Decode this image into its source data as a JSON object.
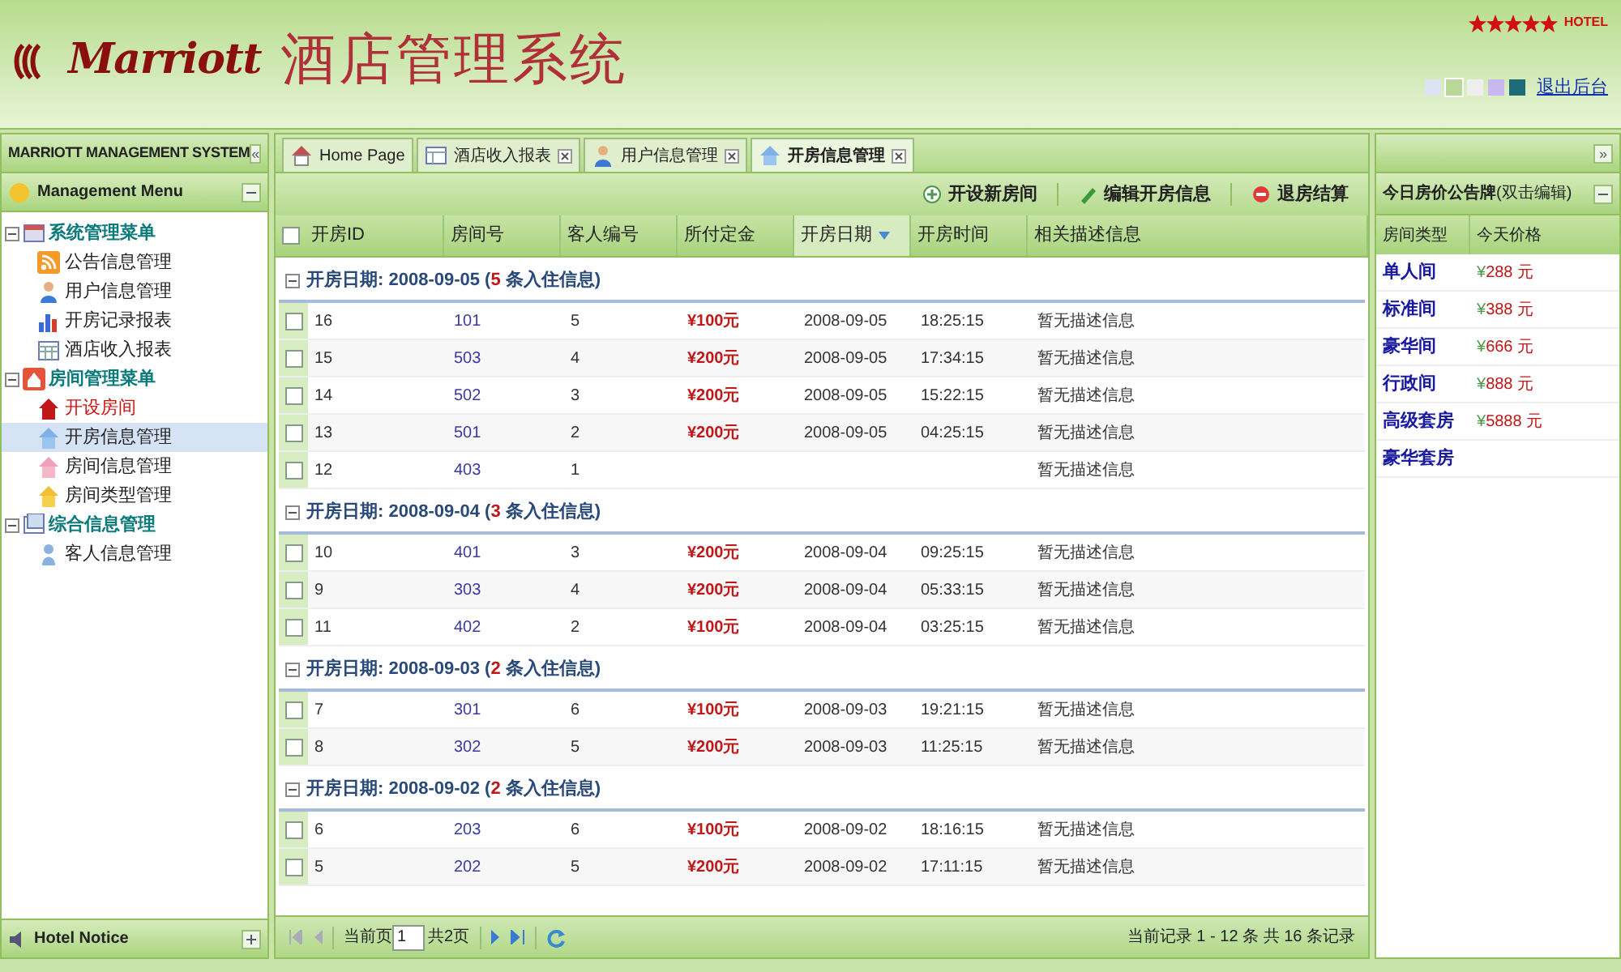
{
  "header": {
    "logo": "Marriott",
    "title": "酒店管理系统",
    "stars": 5,
    "rating_label": "HOTEL",
    "theme_swatches": [
      {
        "color": "#dde3f3",
        "selected": false
      },
      {
        "color": "#b9d99a",
        "selected": true
      },
      {
        "color": "#eeeeee",
        "selected": false
      },
      {
        "color": "#c9b8f0",
        "selected": false
      },
      {
        "color": "#1e6b78",
        "selected": false
      }
    ],
    "logout": "退出后台"
  },
  "sidebar": {
    "title": "MARRIOTT MANAGEMENT SYSTEM",
    "collapse": "«",
    "menu_title": "Management Menu",
    "tree": [
      {
        "label": "系统管理菜单",
        "expanded": true,
        "children": [
          {
            "label": "公告信息管理",
            "selected": false,
            "accent": false
          },
          {
            "label": "用户信息管理",
            "selected": false,
            "accent": false
          },
          {
            "label": "开房记录报表",
            "selected": false,
            "accent": false
          },
          {
            "label": "酒店收入报表",
            "selected": false,
            "accent": false
          }
        ]
      },
      {
        "label": "房间管理菜单",
        "expanded": true,
        "children": [
          {
            "label": "开设房间",
            "selected": false,
            "accent": true
          },
          {
            "label": "开房信息管理",
            "selected": true,
            "accent": false
          },
          {
            "label": "房间信息管理",
            "selected": false,
            "accent": false
          },
          {
            "label": "房间类型管理",
            "selected": false,
            "accent": false
          }
        ]
      },
      {
        "label": "综合信息管理",
        "expanded": true,
        "children": [
          {
            "label": "客人信息管理",
            "selected": false,
            "accent": false
          }
        ]
      }
    ],
    "notice": "Hotel Notice"
  },
  "tabs": [
    {
      "label": "Home Page",
      "selected": false,
      "closable": false
    },
    {
      "label": "酒店收入报表",
      "selected": false,
      "closable": true
    },
    {
      "label": "用户信息管理",
      "selected": false,
      "closable": true
    },
    {
      "label": "开房信息管理",
      "selected": true,
      "closable": true
    }
  ],
  "toolbar": [
    "开设新房间",
    "编辑开房信息",
    "退房结算"
  ],
  "table": {
    "select_all_checked": false,
    "columns": [
      {
        "label": "开房ID",
        "sorted": false
      },
      {
        "label": "房间号",
        "sorted": false
      },
      {
        "label": "客人编号",
        "sorted": false
      },
      {
        "label": "所付定金",
        "sorted": false
      },
      {
        "label": "开房日期",
        "sorted": true
      },
      {
        "label": "开房时间",
        "sorted": false
      },
      {
        "label": "相关描述信息",
        "sorted": false
      }
    ],
    "groups": [
      {
        "prefix": "开房日期: 2008-09-05 (",
        "count": "5",
        "suffix": " 条入住信息)",
        "expanded": true,
        "rows": [
          {
            "checked": false,
            "cells": [
              "16",
              "101",
              "5",
              "¥100元",
              "2008-09-05",
              "18:25:15",
              "暂无描述信息"
            ]
          },
          {
            "checked": false,
            "cells": [
              "15",
              "503",
              "4",
              "¥200元",
              "2008-09-05",
              "17:34:15",
              "暂无描述信息"
            ]
          },
          {
            "checked": false,
            "cells": [
              "14",
              "502",
              "3",
              "¥200元",
              "2008-09-05",
              "15:22:15",
              "暂无描述信息"
            ]
          },
          {
            "checked": false,
            "cells": [
              "13",
              "501",
              "2",
              "¥200元",
              "2008-09-05",
              "04:25:15",
              "暂无描述信息"
            ]
          },
          {
            "checked": false,
            "cells": [
              "12",
              "403",
              "1",
              null,
              null,
              null,
              "暂无描述信息"
            ]
          }
        ]
      },
      {
        "prefix": "开房日期: 2008-09-04 (",
        "count": "3",
        "suffix": " 条入住信息)",
        "expanded": true,
        "rows": [
          {
            "checked": false,
            "cells": [
              "10",
              "401",
              "3",
              "¥200元",
              "2008-09-04",
              "09:25:15",
              "暂无描述信息"
            ]
          },
          {
            "checked": false,
            "cells": [
              "9",
              "303",
              "4",
              "¥200元",
              "2008-09-04",
              "05:33:15",
              "暂无描述信息"
            ]
          },
          {
            "checked": false,
            "cells": [
              "11",
              "402",
              "2",
              "¥100元",
              "2008-09-04",
              "03:25:15",
              "暂无描述信息"
            ]
          }
        ]
      },
      {
        "prefix": "开房日期: 2008-09-03 (",
        "count": "2",
        "suffix": " 条入住信息)",
        "expanded": true,
        "rows": [
          {
            "checked": false,
            "cells": [
              "7",
              "301",
              "6",
              "¥100元",
              "2008-09-03",
              "19:21:15",
              "暂无描述信息"
            ]
          },
          {
            "checked": false,
            "cells": [
              "8",
              "302",
              "5",
              "¥200元",
              "2008-09-03",
              "11:25:15",
              "暂无描述信息"
            ]
          }
        ]
      },
      {
        "prefix": "开房日期: 2008-09-02 (",
        "count": "2",
        "suffix": " 条入住信息)",
        "expanded": true,
        "rows": [
          {
            "checked": false,
            "cells": [
              "6",
              "203",
              "6",
              "¥100元",
              "2008-09-02",
              "18:16:15",
              "暂无描述信息"
            ]
          },
          {
            "checked": false,
            "cells": [
              "5",
              "202",
              "5",
              "¥200元",
              "2008-09-02",
              "17:11:15",
              "暂无描述信息"
            ]
          }
        ]
      }
    ]
  },
  "pager": {
    "page_label": "当前页",
    "page": "1",
    "total": "共2页",
    "status": "当前记录 1 - 12 条 共 16 条记录"
  },
  "price_board": {
    "expand": "»",
    "title": "今日房价公告牌",
    "hint": "(双击编辑)",
    "columns": [
      "房间类型",
      "今天价格"
    ],
    "rows": [
      {
        "type": "单人间",
        "currency": "¥",
        "amount": "288 元"
      },
      {
        "type": "标准间",
        "currency": "¥",
        "amount": "388 元"
      },
      {
        "type": "豪华间",
        "currency": "¥",
        "amount": "666 元"
      },
      {
        "type": "行政间",
        "currency": "¥",
        "amount": "888 元"
      },
      {
        "type": "高级套房",
        "currency": "¥",
        "amount": "5888 元"
      },
      {
        "type": "豪华套房"
      }
    ]
  }
}
